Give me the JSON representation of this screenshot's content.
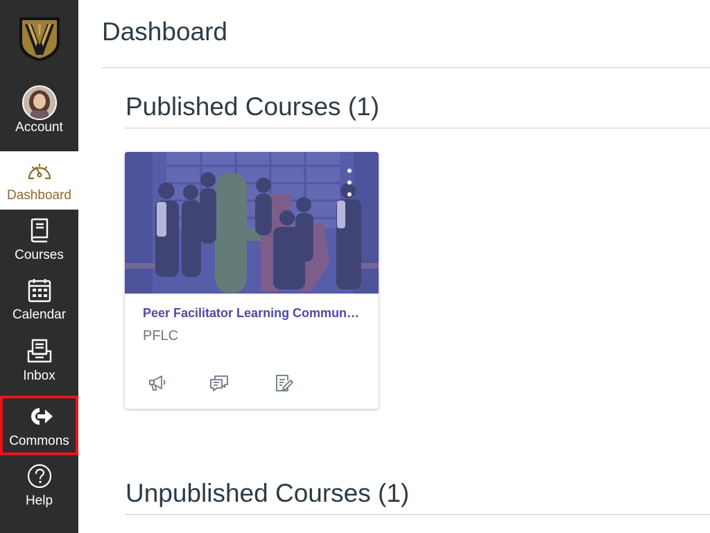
{
  "sidebar": {
    "logo_icon": "university-shield-logo-icon",
    "items": [
      {
        "label": "Account",
        "icon": "avatar"
      },
      {
        "label": "Dashboard",
        "icon": "dashboard-gauge-icon",
        "active": true
      },
      {
        "label": "Courses",
        "icon": "book-icon"
      },
      {
        "label": "Calendar",
        "icon": "calendar-icon"
      },
      {
        "label": "Inbox",
        "icon": "inbox-tray-icon"
      },
      {
        "label": "Commons",
        "icon": "share-arrow-icon",
        "highlighted": true
      },
      {
        "label": "Help",
        "icon": "question-circle-icon"
      }
    ]
  },
  "main": {
    "title": "Dashboard",
    "published_heading": "Published Courses (1)",
    "unpublished_heading": "Unpublished Courses (1)"
  },
  "course_card": {
    "title": "Peer Facilitator Learning Communi…",
    "code": "PFLC",
    "hero_color": "#4f55a3",
    "actions": [
      "announcements-megaphone-icon",
      "discussions-chat-icon",
      "assignments-edit-icon"
    ]
  },
  "colors": {
    "sidebar_bg": "#2d2d2d",
    "active_text": "#8b6a2b",
    "brand_gold": "#9e7e38",
    "highlight_border": "#e8141b",
    "card_title": "#4c4aa5"
  }
}
